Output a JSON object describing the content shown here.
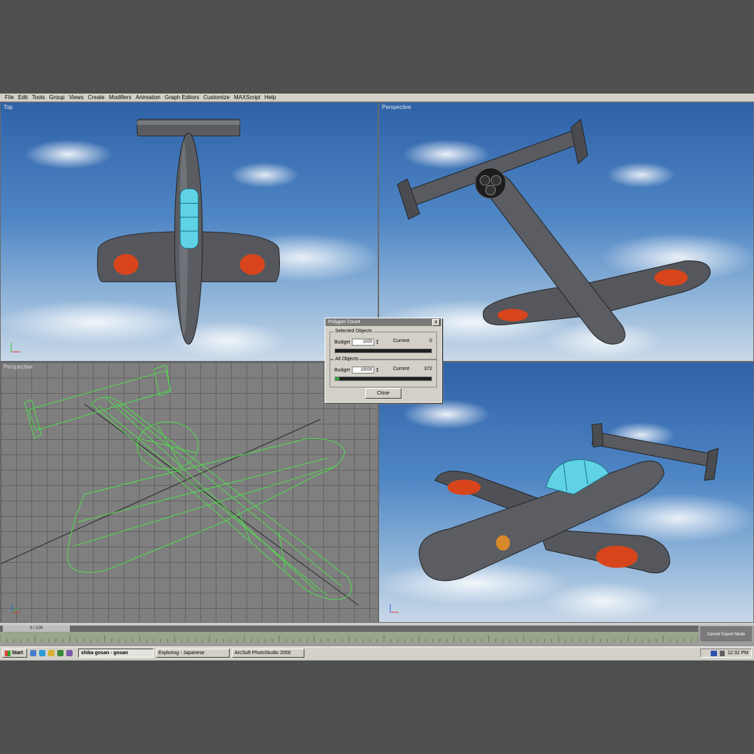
{
  "menu": {
    "items": [
      "File",
      "Edit",
      "Tools",
      "Group",
      "Views",
      "Create",
      "Modifiers",
      "Animation",
      "Graph Editors",
      "Customize",
      "MAXScript",
      "Help"
    ]
  },
  "viewports": {
    "top_left": {
      "label": "Top"
    },
    "top_right": {
      "label": "Perspective"
    },
    "bottom_left": {
      "label": "Perspective"
    },
    "bottom_right": {
      "label": ""
    }
  },
  "dialog": {
    "title": "Polygon Count",
    "close_glyph": "x",
    "selected": {
      "legend": "Selected Objects",
      "budget_label": "Budget",
      "budget_value": "1000",
      "current_label": "Current",
      "current_value": "0",
      "progress": 0
    },
    "all": {
      "legend": "All Objects",
      "budget_label": "Budget",
      "budget_value": "10000",
      "current_label": "Current",
      "current_value": "372",
      "progress": 0.04
    },
    "close_button": "Close"
  },
  "timeline": {
    "frame_indicator": "0 / 100",
    "expert_button": "Cancel Expert Mode"
  },
  "taskbar": {
    "start": "Start",
    "tasks": [
      "shika gosan - gosan",
      "Exploring - Japanese",
      "ArcSoft PhotoStudio 2000"
    ],
    "active_index": 0,
    "clock": "12:32 PM"
  },
  "colors": {
    "plane_body": "#55575c",
    "roundel": "#d8451c",
    "canopy": "#5fd2e6",
    "wire": "#4ee04a"
  },
  "icons": {
    "start": "windows-logo-icon",
    "dialog_close": "close-icon",
    "axis": "axis-tripod-icon"
  }
}
